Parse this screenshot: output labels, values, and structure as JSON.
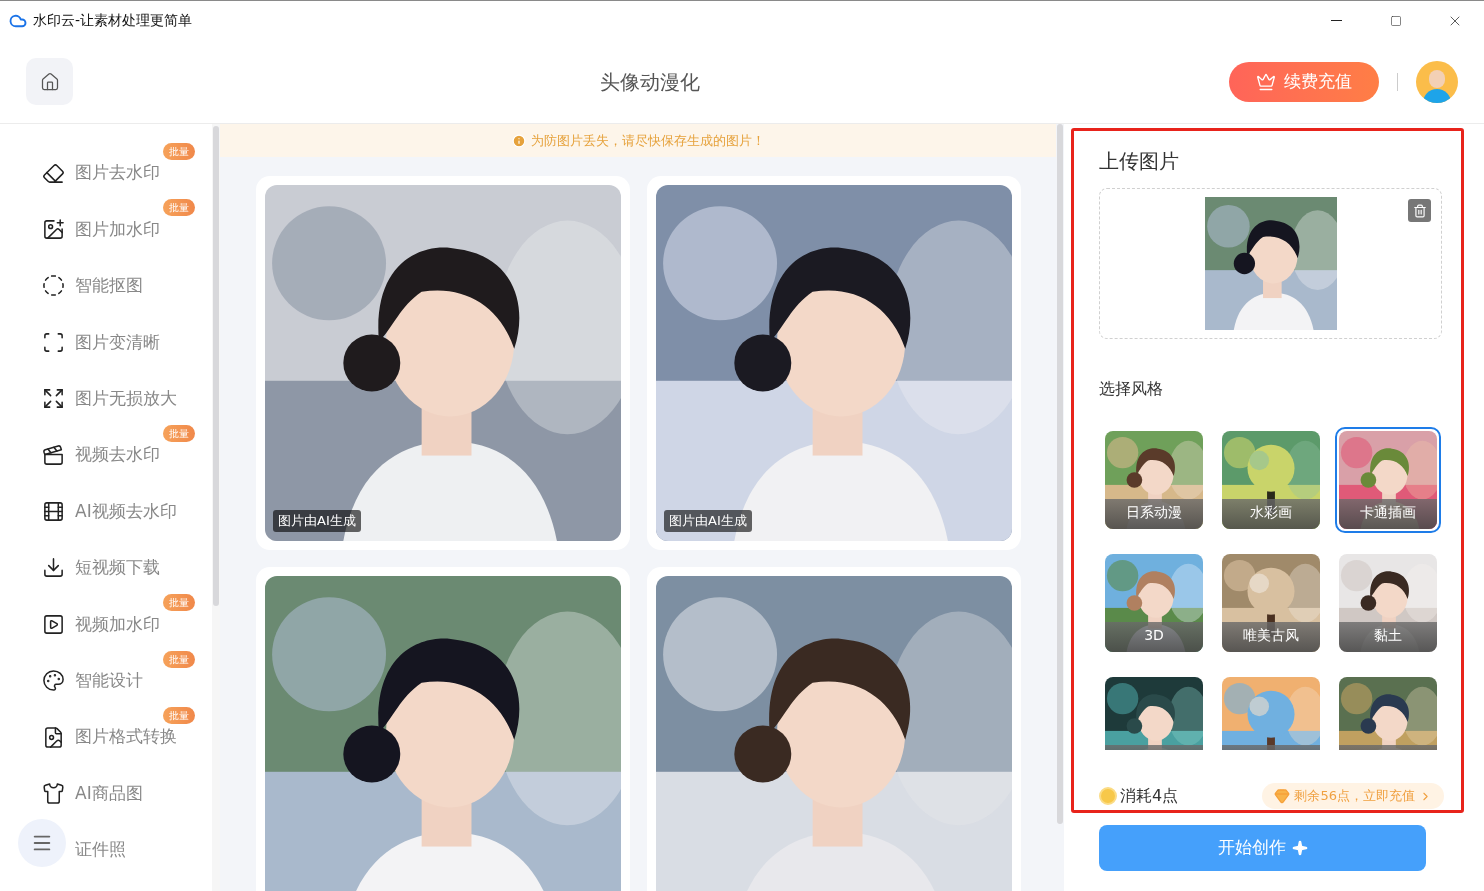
{
  "window": {
    "title": "水印云-让素材处理更简单"
  },
  "header": {
    "title": "头像动漫化",
    "recharge_button": "续费充值"
  },
  "sidebar": {
    "items": [
      {
        "label": "图片去水印",
        "badge": "批量"
      },
      {
        "label": "图片加水印",
        "badge": "批量"
      },
      {
        "label": "智能抠图"
      },
      {
        "label": "图片变清晰"
      },
      {
        "label": "图片无损放大"
      },
      {
        "label": "视频去水印",
        "badge": "批量"
      },
      {
        "label": "AI视频去水印"
      },
      {
        "label": "短视频下载"
      },
      {
        "label": "视频加水印",
        "badge": "批量"
      },
      {
        "label": "智能设计",
        "badge": "批量"
      },
      {
        "label": "图片格式转换",
        "badge": "批量"
      },
      {
        "label": "AI商品图"
      },
      {
        "label": "证件照"
      }
    ]
  },
  "notice": "为防图片丢失，请尽快保存生成的图片！",
  "gallery": [
    {
      "kind": "picture",
      "caption": "图片由AI生成"
    },
    {
      "kind": "picture",
      "caption": "图片由AI生成"
    },
    {
      "kind": "picture"
    },
    {
      "kind": "picture"
    }
  ],
  "upload": {
    "title": "上传图片",
    "thumbnail": {
      "kind": "picture"
    }
  },
  "styles": {
    "title": "选择风格",
    "items": [
      {
        "label": "日系动漫",
        "selected": false
      },
      {
        "label": "水彩画",
        "selected": false
      },
      {
        "label": "卡通插画",
        "selected": true
      },
      {
        "label": "3D",
        "selected": false
      },
      {
        "label": "唯美古风",
        "selected": false
      },
      {
        "label": "黏土",
        "selected": false
      },
      {
        "selected": false
      },
      {
        "selected": false
      },
      {
        "selected": false
      }
    ]
  },
  "footer": {
    "cost": "消耗4点",
    "balance": "剩余56点，立即充值",
    "start_button": "开始创作"
  }
}
